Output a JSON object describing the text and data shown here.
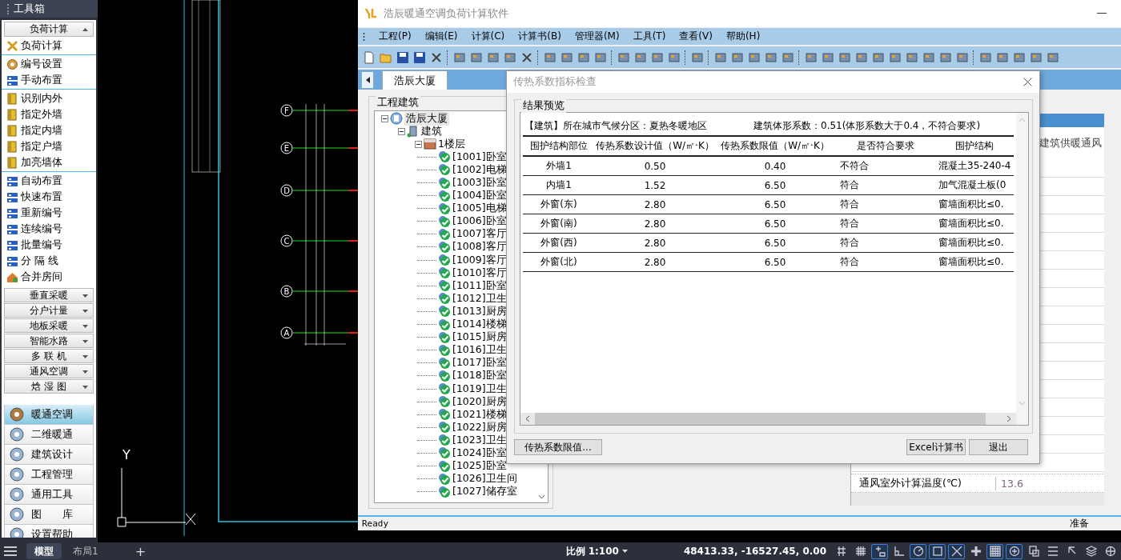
{
  "toolbox": {
    "title": "工具箱",
    "section": {
      "label": "负荷计算",
      "expanded": true
    },
    "groups": [
      [
        {
          "label": "负荷计算"
        }
      ],
      [
        {
          "label": "编号设置"
        },
        {
          "label": "手动布置"
        }
      ],
      [
        {
          "label": "识别内外"
        },
        {
          "label": "指定外墙"
        },
        {
          "label": "指定内墙"
        },
        {
          "label": "指定户墙"
        },
        {
          "label": "加亮墙体"
        }
      ],
      [
        {
          "label": "自动布置"
        },
        {
          "label": "快速布置"
        },
        {
          "label": "重新编号"
        },
        {
          "label": "连续编号"
        },
        {
          "label": "批量编号"
        },
        {
          "label": "分 隔 线"
        },
        {
          "label": "合并房间"
        }
      ]
    ],
    "collapsed_sections": [
      "垂直采暖",
      "分户计量",
      "地板采暖",
      "智能水路",
      "多 联 机",
      "通风空调",
      "焓 湿 图"
    ],
    "categories": [
      {
        "label": "暖通空调",
        "selected": true
      },
      {
        "label": "二维暖通",
        "selected": false
      },
      {
        "label": "建筑设计",
        "selected": false
      },
      {
        "label": "工程管理",
        "selected": false
      },
      {
        "label": "通用工具",
        "selected": false
      },
      {
        "label": "图　　库",
        "selected": false
      },
      {
        "label": "设置帮助",
        "selected": false
      }
    ]
  },
  "cad": {
    "axes": [
      "F",
      "E",
      "D",
      "C",
      "B",
      "A"
    ],
    "ucs_label": "Y"
  },
  "app": {
    "title": "浩辰暖通空调负荷计算软件",
    "menu": [
      "工程(P)",
      "编辑(E)",
      "计算(C)",
      "计算书(B)",
      "管理器(M)",
      "工具(T)",
      "查看(V)",
      "帮助(H)"
    ],
    "tab": {
      "label": "浩辰大厦",
      "selected": true
    },
    "tree_group": "工程建筑",
    "tree": {
      "label": "浩辰大厦",
      "selected": true,
      "expanded": true,
      "children": [
        {
          "label": "建筑",
          "selected": false,
          "expanded": true,
          "children": [
            {
              "label": "1楼层",
              "selected": false,
              "expanded": true,
              "children": [
                {
                  "label": "[1001]卧室",
                  "selected": false
                },
                {
                  "label": "[1002]电梯",
                  "selected": false
                },
                {
                  "label": "[1003]卧室",
                  "selected": false
                },
                {
                  "label": "[1004]卧室",
                  "selected": false
                },
                {
                  "label": "[1005]电梯",
                  "selected": false
                },
                {
                  "label": "[1006]卧室",
                  "selected": false
                },
                {
                  "label": "[1007]客厅",
                  "selected": false
                },
                {
                  "label": "[1008]客厅",
                  "selected": false
                },
                {
                  "label": "[1009]客厅",
                  "selected": false
                },
                {
                  "label": "[1010]客厅",
                  "selected": false
                },
                {
                  "label": "[1011]卧室",
                  "selected": false
                },
                {
                  "label": "[1012]卫生",
                  "selected": false
                },
                {
                  "label": "[1013]厨房",
                  "selected": false
                },
                {
                  "label": "[1014]楼梯",
                  "selected": false
                },
                {
                  "label": "[1015]厨房",
                  "selected": false
                },
                {
                  "label": "[1016]卫生",
                  "selected": false
                },
                {
                  "label": "[1017]卧室",
                  "selected": false
                },
                {
                  "label": "[1018]卧室",
                  "selected": false
                },
                {
                  "label": "[1019]卫生",
                  "selected": false
                },
                {
                  "label": "[1020]厨房",
                  "selected": false
                },
                {
                  "label": "[1021]楼梯",
                  "selected": false
                },
                {
                  "label": "[1022]厨房",
                  "selected": false
                },
                {
                  "label": "[1023]卫生",
                  "selected": false
                },
                {
                  "label": "[1024]卧室",
                  "selected": false
                },
                {
                  "label": "[1025]卧室",
                  "selected": false
                },
                {
                  "label": "[1026]卫生间",
                  "selected": false
                },
                {
                  "label": "[1027]储存室",
                  "selected": false
                }
              ]
            }
          ]
        }
      ]
    },
    "side_panel": {
      "note": "建筑供暖通风",
      "rows": [
        {
          "label": "通风室外计算温度(℃)",
          "value": "13.6"
        }
      ]
    },
    "status_left": "Ready",
    "status_right": "准备"
  },
  "dialog": {
    "title": "传热系数指标检查",
    "group": "结果预览",
    "info_left": "【建筑】所在城市气候分区：夏热冬暖地区",
    "info_right": "建筑体形系数：0.51(体形系数大于0.4，不符合要求)",
    "columns": [
      "围护结构部位",
      "传热系数设计值（W/㎡·K）",
      "传热系数限值（W/㎡·K）",
      "是否符合要求",
      "围护结构"
    ],
    "rows": [
      [
        "外墙1",
        "0.50",
        "0.40",
        "不符合",
        "混凝土35-240-4"
      ],
      [
        "内墙1",
        "1.52",
        "6.50",
        "符合",
        "加气混凝土板(0"
      ],
      [
        "外窗(东)",
        "2.80",
        "6.50",
        "符合",
        "窗墙面积比≤0."
      ],
      [
        "外窗(南)",
        "2.80",
        "6.50",
        "符合",
        "窗墙面积比≤0."
      ],
      [
        "外窗(西)",
        "2.80",
        "6.50",
        "符合",
        "窗墙面积比≤0."
      ],
      [
        "外窗(北)",
        "2.80",
        "6.50",
        "符合",
        "窗墙面积比≤0."
      ]
    ],
    "buttons": [
      "传热系数限值...",
      "Excel计算书",
      "退出"
    ]
  },
  "bottom_bar": {
    "tabs": [
      {
        "label": "模型",
        "selected": true
      },
      {
        "label": "布局1",
        "selected": false
      }
    ],
    "add": "+",
    "scale": "比例 1:100",
    "coords": "48413.33, -16527.45, 0.00",
    "toggles": [
      {
        "kind": "grid",
        "on": false
      },
      {
        "kind": "hash",
        "on": false
      },
      {
        "kind": "plusbox",
        "on": true
      },
      {
        "kind": "angle",
        "on": false
      },
      {
        "kind": "circle",
        "on": true
      },
      {
        "kind": "square",
        "on": true
      },
      {
        "kind": "cross",
        "on": true
      },
      {
        "kind": "plus",
        "on": false
      },
      {
        "kind": "checker",
        "on": true
      },
      {
        "kind": "circleplus",
        "on": true
      },
      {
        "kind": "doc",
        "on": false
      },
      {
        "kind": "lines",
        "on": false
      },
      {
        "kind": "pointer",
        "on": false
      },
      {
        "kind": "layers",
        "on": false
      },
      {
        "kind": "globe",
        "on": false
      }
    ]
  }
}
